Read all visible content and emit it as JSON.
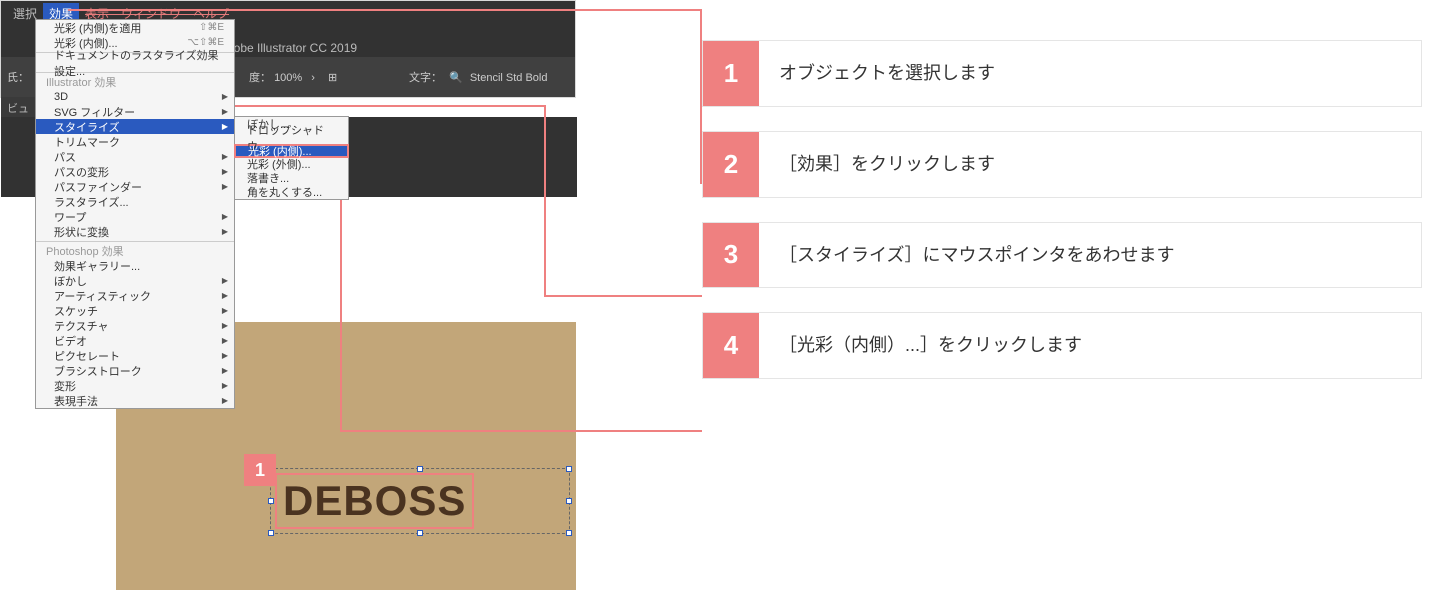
{
  "menubar": {
    "select": "選択",
    "effects": "効果",
    "rest": "表示　ウィンドウ　ヘルプ"
  },
  "app": {
    "title": "Adobe Illustrator CC 2019",
    "zoom_label": "度：",
    "zoom_value": "100%",
    "moji_label": "文字：",
    "moji_value": "Stencil Std Bold",
    "side_tab": "ビュー)",
    "left_label": "氏："
  },
  "dropdown": {
    "apply_inner_glow": "光彩 (内側)を適用",
    "apply_key": "⇧⌘E",
    "inner_glow": "光彩 (内側)...",
    "inner_glow_key": "⌥⇧⌘E",
    "raster_settings": "ドキュメントのラスタライズ効果設定...",
    "illustrator_effects": "Illustrator 効果",
    "threeD": "3D",
    "svg_filter": "SVG フィルター",
    "stylize": "スタイライズ",
    "trim_marks": "トリムマーク",
    "path": "パス",
    "path_distort": "パスの変形",
    "pathfinder": "パスファインダー",
    "rasterize": "ラスタライズ...",
    "warp": "ワープ",
    "convert_shape": "形状に変換",
    "photoshop_effects": "Photoshop 効果",
    "effect_gallery": "効果ギャラリー...",
    "blur": "ぼかし",
    "artistic": "アーティスティック",
    "sketch": "スケッチ",
    "texture": "テクスチャ",
    "video": "ビデオ",
    "pixelate": "ピクセレート",
    "brush_stroke": "ブラシストローク",
    "distort": "変形",
    "stylize_ps": "表現手法"
  },
  "submenu": {
    "blur": "ぼかし...",
    "drop_shadow": "ドロップシャドウ...",
    "inner_glow": "光彩 (内側)...",
    "outer_glow": "光彩 (外側)...",
    "scribble": "落書き...",
    "round_corners": "角を丸くする..."
  },
  "canvas": {
    "badge": "1",
    "text": "DEBOSS"
  },
  "steps": [
    {
      "n": "1",
      "t": "オブジェクトを選択します"
    },
    {
      "n": "2",
      "t": "［効果］をクリックします"
    },
    {
      "n": "3",
      "t": "［スタイライズ］にマウスポインタをあわせます"
    },
    {
      "n": "4",
      "t": "［光彩（内側）...］をクリックします"
    }
  ]
}
